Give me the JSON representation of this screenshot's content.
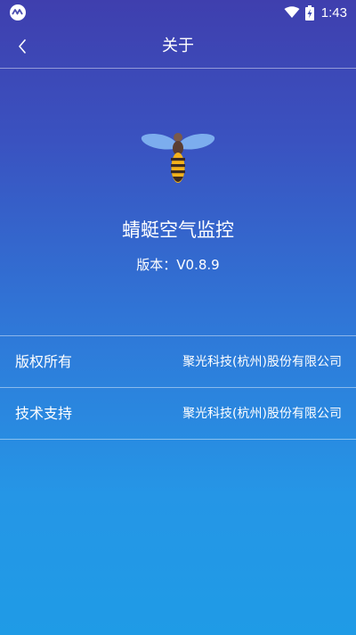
{
  "status_bar": {
    "time": "1:43",
    "icons": [
      "app-notification-icon",
      "wifi-icon",
      "battery-charging-icon"
    ]
  },
  "header": {
    "title": "关于",
    "back_icon": "chevron-left-icon"
  },
  "app": {
    "logo_icon": "dragonfly-icon",
    "name": "蜻蜓空气监控",
    "version": "版本：V0.8.9"
  },
  "info": {
    "rows": [
      {
        "label": "版权所有",
        "value": "聚光科技(杭州)股份有限公司"
      },
      {
        "label": "技术支持",
        "value": "聚光科技(杭州)股份有限公司"
      }
    ]
  },
  "colors": {
    "gradient_top": "#3f3fae",
    "gradient_bottom": "#1f9be6",
    "text": "#ffffff",
    "wing": "#7fb2f0",
    "body_yellow": "#f5b21b",
    "body_dark": "#3b2a22"
  }
}
